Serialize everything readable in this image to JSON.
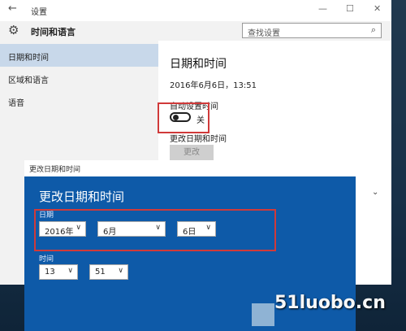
{
  "window": {
    "title": "设置",
    "back_glyph": "←",
    "min_glyph": "—",
    "max_glyph": "☐",
    "close_glyph": "✕"
  },
  "header": {
    "app_title": "时间和语言",
    "search_placeholder": "查找设置"
  },
  "sidebar": {
    "items": [
      {
        "label": "日期和时间",
        "active": true
      },
      {
        "label": "区域和语言",
        "active": false
      },
      {
        "label": "语音",
        "active": false
      }
    ]
  },
  "content": {
    "heading": "日期和时间",
    "current_datetime": "2016年6月6日，13:51",
    "auto_time_label": "自动设置时间",
    "auto_time_state": "关",
    "change_label": "更改日期和时间",
    "change_button": "更改"
  },
  "dialog": {
    "title": "更改日期和时间",
    "heading": "更改日期和时间",
    "date_label": "日期",
    "time_label": "时间",
    "year": "2016年",
    "month": "6月",
    "day": "6日",
    "hour": "13",
    "minute": "51"
  },
  "watermark": {
    "text": "51luobo.cn"
  },
  "colors": {
    "dialog_blue": "#0e5aa8",
    "active_nav": "#c8d8ea",
    "highlight_red": "#d03a3a"
  },
  "icons": {
    "gear": "gear-icon",
    "search": "search-icon",
    "chevron": "chevron-down-icon"
  }
}
